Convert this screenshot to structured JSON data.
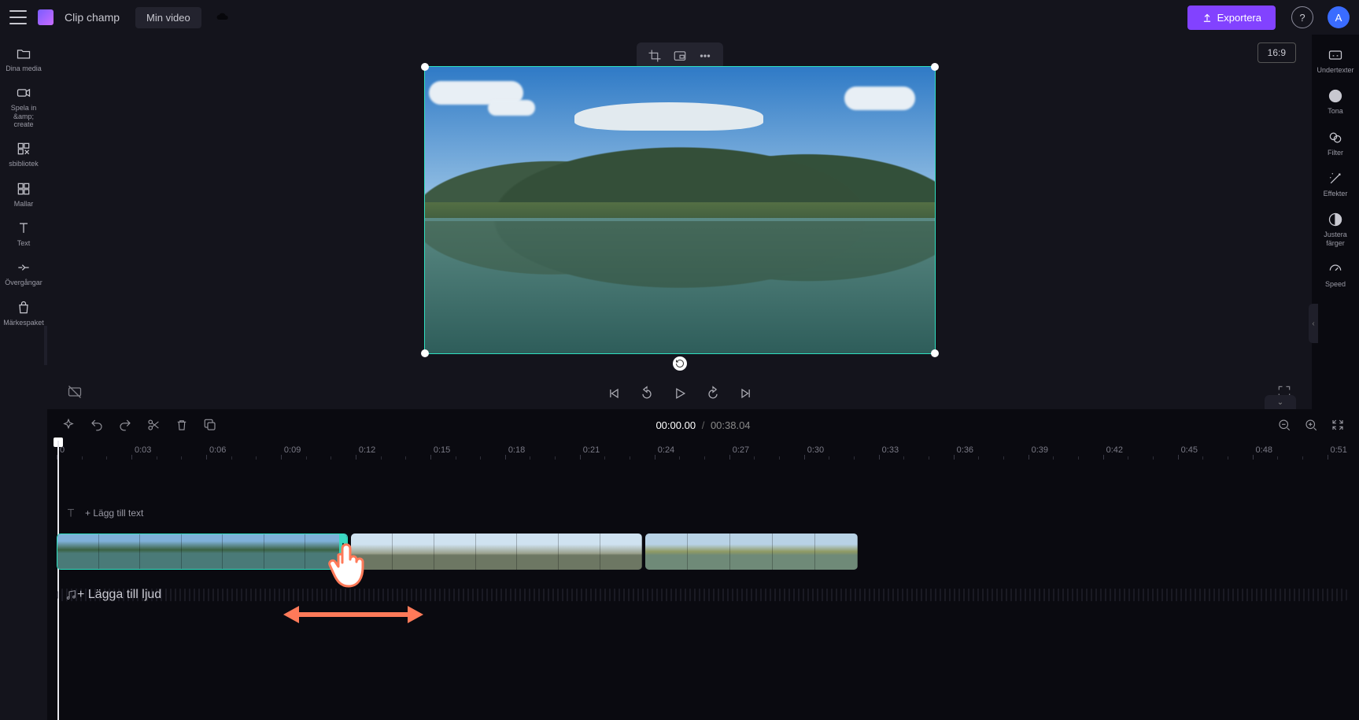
{
  "header": {
    "brand": "Clip champ",
    "project_name": "Min video",
    "export_label": "Exportera",
    "avatar_initial": "A",
    "aspect_ratio_label": "16:9"
  },
  "left_sidebar": {
    "items": [
      {
        "label": "Dina media"
      },
      {
        "label": "Spela in &amp;\ncreate"
      },
      {
        "label": "sbibliotek"
      },
      {
        "label": "Mallar"
      },
      {
        "label": "Text"
      },
      {
        "label": "Övergångar"
      },
      {
        "label": "Märkespaket"
      }
    ]
  },
  "right_sidebar": {
    "items": [
      {
        "label": "Undertexter"
      },
      {
        "label": "Tona"
      },
      {
        "label": "Filter"
      },
      {
        "label": "Effekter"
      },
      {
        "label": "Justera\nfärger"
      },
      {
        "label": "Speed"
      }
    ]
  },
  "timeline": {
    "current_time": "00:00.00",
    "total_time": "00:38.04",
    "ruler_start_label": "0",
    "tick_labels": [
      "0:03",
      "0:06",
      "0:09",
      "0:12",
      "0:15",
      "0:18",
      "0:21",
      "0:24",
      "0:27",
      "0:30",
      "0:33",
      "0:36",
      "0:39",
      "0:42",
      "0:45",
      "0:48",
      "0:51"
    ],
    "add_text_label": "Lägg till text",
    "add_audio_label": "Lägga till ljud"
  }
}
